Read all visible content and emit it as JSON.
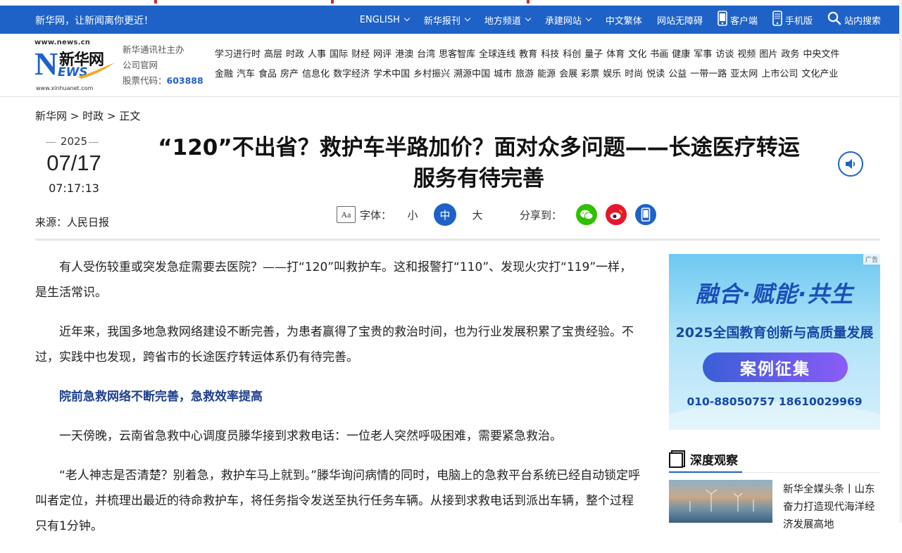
{
  "topbar": {
    "slogan": "新华网，让新闻离你更近！",
    "nav": [
      {
        "label": "ENGLISH",
        "dropdown": true
      },
      {
        "label": "新华报刊",
        "dropdown": true
      },
      {
        "label": "地方频道",
        "dropdown": true
      },
      {
        "label": "承建网站",
        "dropdown": true
      },
      {
        "label": "中文繁体",
        "dropdown": false
      },
      {
        "label": "网站无障碍",
        "dropdown": false
      }
    ],
    "client": "客户端",
    "mobile": "手机版",
    "search": "站内搜索"
  },
  "logo": {
    "url_top": "www.news.cn",
    "name": "新华网",
    "letter": "N",
    "ews": "EWS",
    "url_bottom": "www.xinhuanet.com"
  },
  "org": {
    "line1": "新华通讯社主办",
    "line2": "公司官网",
    "stock_label": "股票代码：",
    "stock_code": "603888"
  },
  "channels": {
    "row1": [
      "学习进行时",
      "高层",
      "时政",
      "人事",
      "国际",
      "财经",
      "网评",
      "港澳",
      "台湾",
      "思客智库",
      "全球连线",
      "教育",
      "科技",
      "科创",
      "量子",
      "体育",
      "文化",
      "书画",
      "健康",
      "军事",
      "访谈",
      "视频",
      "图片",
      "政务",
      "中央文件"
    ],
    "row2": [
      "金融",
      "汽车",
      "食品",
      "房产",
      "信息化",
      "数字经济",
      "学术中国",
      "乡村振兴",
      "溯源中国",
      "城市",
      "旅游",
      "能源",
      "会展",
      "彩票",
      "娱乐",
      "时尚",
      "悦读",
      "公益",
      "一带一路",
      "亚太网",
      "上市公司",
      "文化产业"
    ]
  },
  "breadcrumb": {
    "home": "新华网",
    "sep": ">",
    "section": "时政",
    "current": "正文"
  },
  "date": {
    "year": "2025",
    "month_day": "07/17",
    "time": "07:17:13"
  },
  "source": "来源：人民日报",
  "headline": {
    "line1": "“120”不出省？救护车半路加价？面对众多问题——长途医疗转运",
    "line2": "服务有待完善"
  },
  "tools": {
    "font_label": "字体：",
    "aa": "Aa",
    "small": "小",
    "medium": "中",
    "large": "大",
    "share_label": "分享到："
  },
  "article": {
    "p1": "有人受伤较重或突发急症需要去医院？——打“120”叫救护车。这和报警打“110”、发现火灾打“119”一样，是生活常识。",
    "p2": "近年来，我国多地急救网络建设不断完善，为患者赢得了宝贵的救治时间，也为行业发展积累了宝贵经验。不过，实践中也发现，跨省市的长途医疗转运体系仍有待完善。",
    "subhead": "院前急救网络不断完善，急救效率提高",
    "p3": "一天傍晚，云南省急救中心调度员滕华接到求救电话：一位老人突然呼吸困难，需要紧急救治。",
    "p4": "“老人神志是否清楚？别着急，救护车马上就到。”滕华询问病情的同时，电脑上的急救平台系统已经自动锁定呼叫者定位，并梳理出最近的待命救护车，将任务指令发送至执行任务车辆。从接到求救电话到派出车辆，整个过程只有1分钟。"
  },
  "ad": {
    "tag": "广告",
    "title": "融合·赋能·共生",
    "subtitle": "2025全国教育创新与高质量发展",
    "button": "案例征集",
    "phones": "010-88050757  18610029969"
  },
  "sidebar": {
    "section_title": "深度观察",
    "news_title": "新华全媒头条丨山东奋力打造现代海洋经济发展高地"
  },
  "colors": {
    "brand_blue": "#1e62c8",
    "subhead": "#1d3f8f",
    "wechat": "#2dc100",
    "weibo": "#e6162d"
  }
}
